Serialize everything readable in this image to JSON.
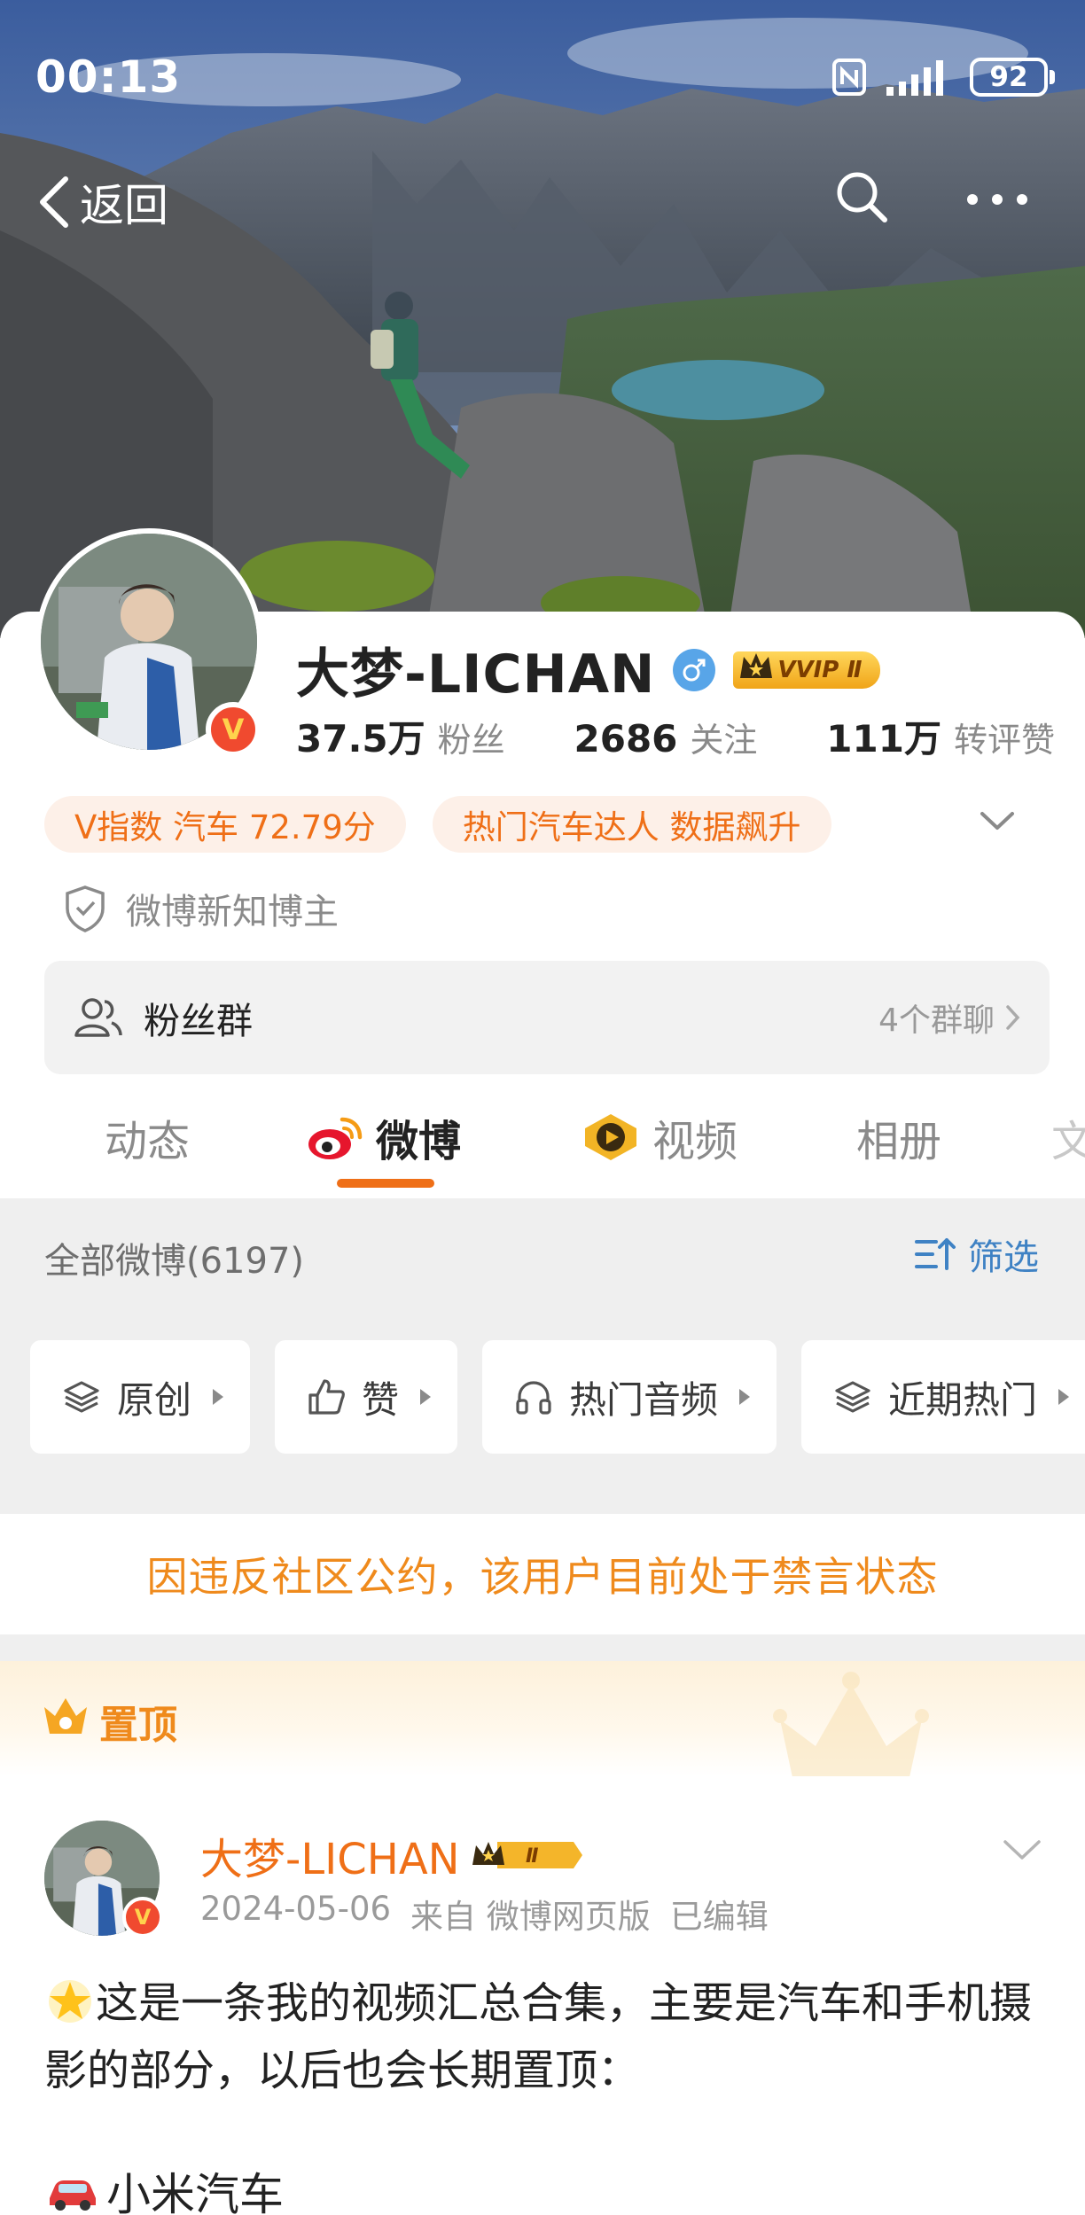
{
  "status_bar": {
    "time": "00:13",
    "battery": "92"
  },
  "nav": {
    "back_label": "返回"
  },
  "profile": {
    "name": "大梦-LICHAN",
    "vip_label": "VVIP Ⅱ",
    "stats": [
      {
        "num": "37.5万",
        "label": "粉丝"
      },
      {
        "num": "2686",
        "label": "关注"
      },
      {
        "num": "111万",
        "label": "转评赞"
      }
    ],
    "tags": [
      "V指数 汽车 72.79分",
      "热门汽车达人 数据飙升"
    ],
    "new_blogger": "微博新知博主",
    "fan_group": {
      "label": "粉丝群",
      "count": "4个群聊"
    }
  },
  "tabs": [
    {
      "label": "动态",
      "icon": "none"
    },
    {
      "label": "微博",
      "icon": "weibo-logo-icon"
    },
    {
      "label": "视频",
      "icon": "video-play-icon"
    },
    {
      "label": "相册",
      "icon": "none"
    },
    {
      "label": "文",
      "icon": "none"
    }
  ],
  "feed": {
    "all_label": "全部微博(6197)",
    "filter_label": "筛选",
    "chips": [
      "原创",
      "赞",
      "热门音频",
      "近期热门"
    ]
  },
  "ban_notice": "因违反社区公约，该用户目前处于禁言状态",
  "pinned_label": "置顶",
  "post": {
    "name": "大梦-LICHAN",
    "vip_label": "Ⅱ",
    "meta": [
      "2024-05-06",
      "来自 微博网页版",
      "已编辑"
    ],
    "text": "这是一条我的视频汇总合集，主要是汽车和手机摄影的部分，以后也会长期置顶：",
    "sub_heading": "小米汽车"
  },
  "colors": {
    "accent_orange": "#ef6f17",
    "link_blue": "#3f82c4",
    "ban_orange": "#ef8a1c"
  }
}
